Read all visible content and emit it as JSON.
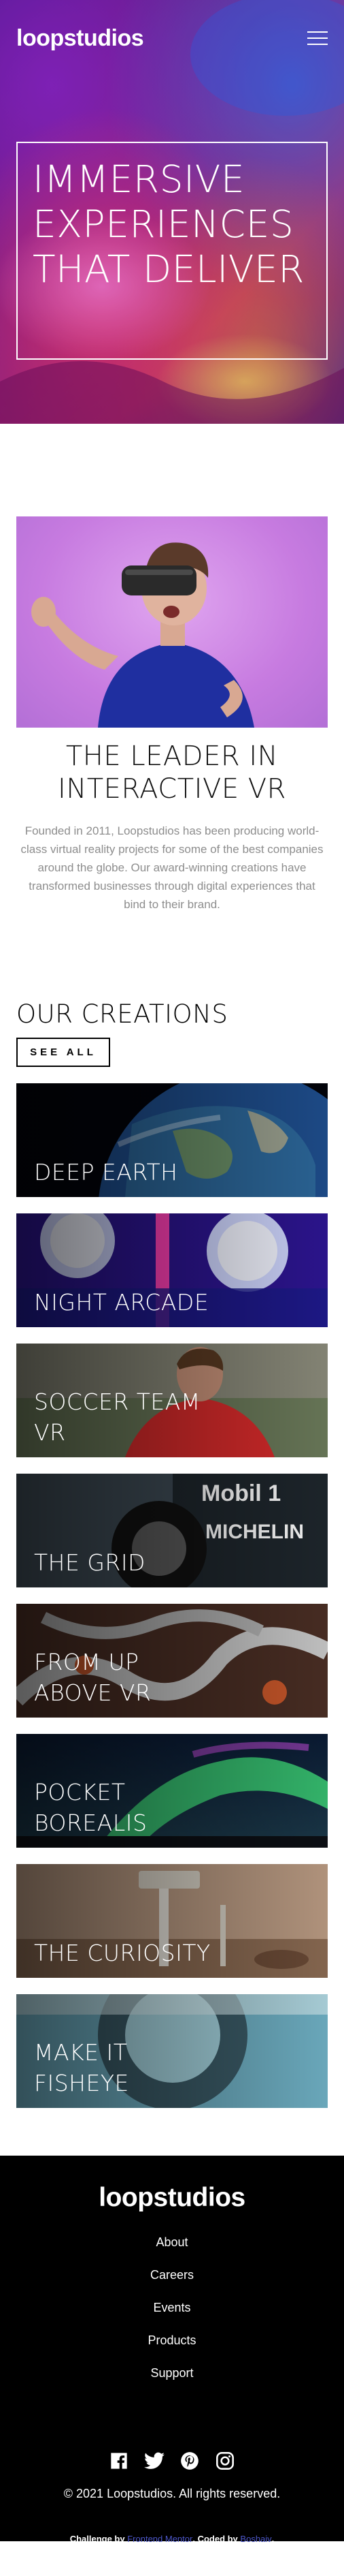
{
  "header": {
    "logo": "loopstudios",
    "menu_icon": "hamburger-menu-icon"
  },
  "hero": {
    "title": "Immersive experiences that deliver"
  },
  "intro": {
    "heading": "The leader in interactive VR",
    "text": "Founded in 2011, Loopstudios has been producing world-class virtual reality projects for some of the best companies around the globe. Our award-winning creations have transformed businesses through digital experiences that bind to their brand."
  },
  "creations": {
    "heading": "Our creations",
    "see_all_label": "See all",
    "items": [
      {
        "title": "Deep earth"
      },
      {
        "title": "Night arcade"
      },
      {
        "title": "Soccer team VR"
      },
      {
        "title": "The grid"
      },
      {
        "title": "From up above VR"
      },
      {
        "title": "Pocket borealis"
      },
      {
        "title": "The curiosity"
      },
      {
        "title": "Make it fisheye"
      }
    ]
  },
  "footer": {
    "logo": "loopstudios",
    "nav": [
      "About",
      "Careers",
      "Events",
      "Products",
      "Support"
    ],
    "socials": [
      "facebook-icon",
      "twitter-icon",
      "pinterest-icon",
      "instagram-icon"
    ],
    "copyright": "© 2021 Loopstudios. All rights reserved.",
    "attribution": {
      "challenge_by_label": "Challenge by",
      "challenge_by_link": "Frontend Mentor",
      "coded_by_label": ". Coded by",
      "coded_by_link": "Boshaiv",
      "end": "."
    }
  },
  "colors": {
    "footer_bg": "#000000",
    "intro_text": "#8d8d8d",
    "attribution_link": "#4b55c7"
  }
}
